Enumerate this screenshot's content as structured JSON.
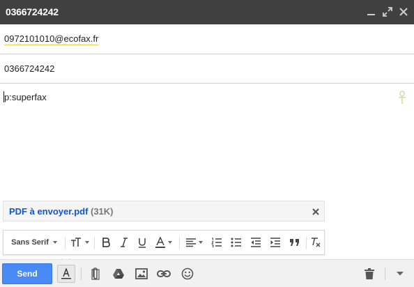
{
  "window": {
    "title": "0366724242",
    "minimize_icon": "minimize-icon",
    "expand_icon": "expand-icon",
    "close_icon": "close-icon"
  },
  "compose": {
    "to": "0972101010@ecofax.fr",
    "subject": "0366724242",
    "body": "p:superfax",
    "signature_icon": "ankh-icon"
  },
  "attachment": {
    "name": "PDF à envoyer.pdf",
    "size": "(31K)"
  },
  "formatting": {
    "font": "Sans Serif",
    "tools": [
      "font-size-icon",
      "bold-icon",
      "italic-icon",
      "underline-icon",
      "text-color-icon",
      "align-icon",
      "numbered-list-icon",
      "bulleted-list-icon",
      "indent-less-icon",
      "indent-more-icon",
      "quote-icon",
      "remove-formatting-icon"
    ]
  },
  "bottom": {
    "send_label": "Send",
    "tools": [
      "formatting-icon",
      "attach-icon",
      "drive-icon",
      "photo-icon",
      "link-icon",
      "emoji-icon",
      "trash-icon",
      "more-options-icon"
    ]
  },
  "colors": {
    "titlebar": "#404040",
    "send_button": "#4a8af4",
    "attachment_link": "#1155cc",
    "recipient_underline": "#e6d24a"
  }
}
